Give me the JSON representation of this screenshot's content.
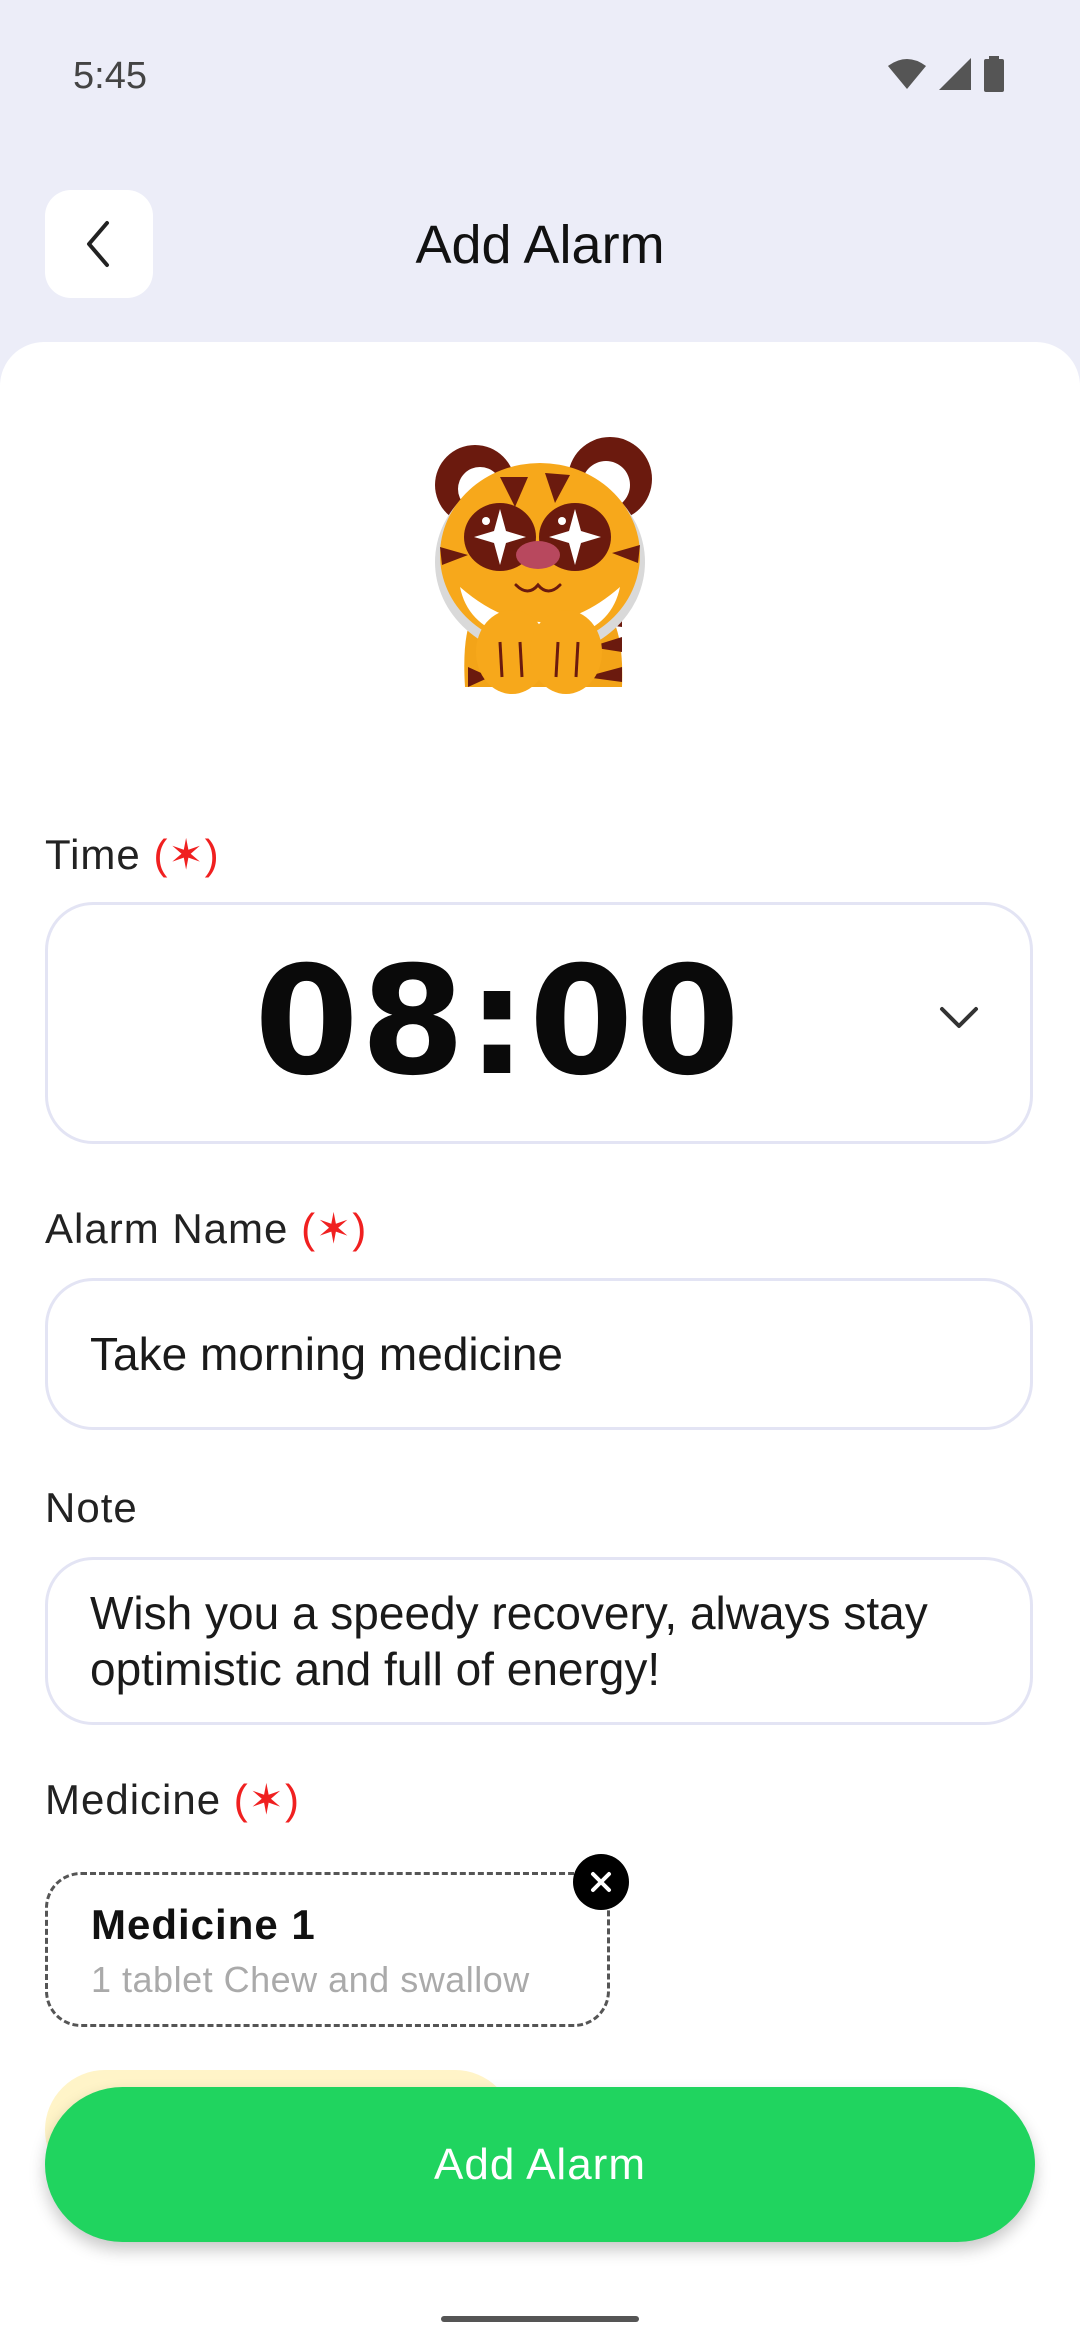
{
  "status_bar": {
    "time": "5:45",
    "icons": [
      "wifi-icon",
      "signal-icon",
      "battery-icon"
    ]
  },
  "header": {
    "title": "Add Alarm",
    "back_icon": "chevron-left-icon"
  },
  "form": {
    "required_mark": "(✶)",
    "time": {
      "label": "Time",
      "value": "08:00",
      "dropdown_icon": "chevron-down-icon"
    },
    "alarm_name": {
      "label": "Alarm Name",
      "value": "Take morning medicine"
    },
    "note": {
      "label": "Note",
      "value_line1": "Wish you a speedy recovery, always stay",
      "value_line2": "optimistic and full of energy!"
    },
    "medicine": {
      "label": "Medicine",
      "items": [
        {
          "name": "Medicine 1",
          "description": "1 tablet Chew and swallow"
        }
      ],
      "remove_icon": "close-icon"
    }
  },
  "actions": {
    "submit_label": "Add Alarm"
  },
  "colors": {
    "background": "#ECEDF8",
    "primary": "#20D45F",
    "required": "#F02020",
    "border": "#E3E4F4"
  }
}
